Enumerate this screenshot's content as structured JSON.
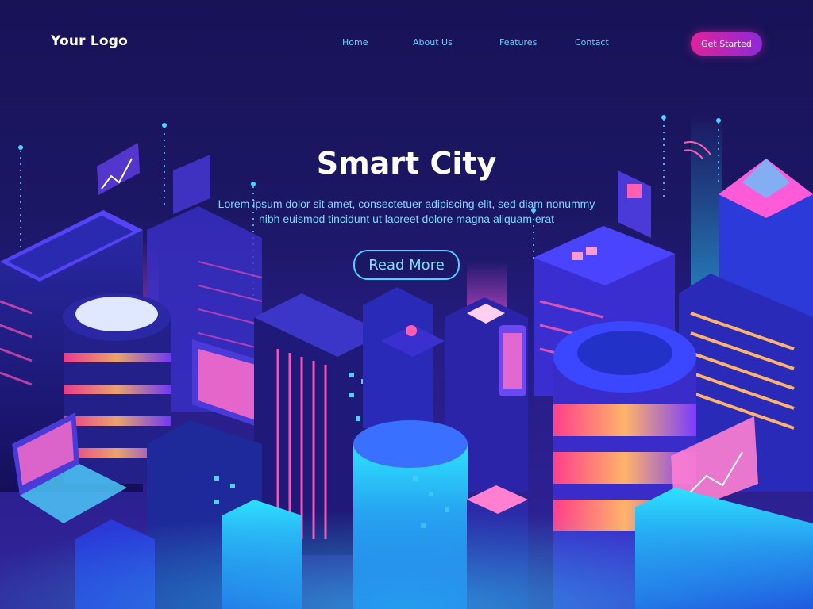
{
  "header": {
    "logo": "Your Logo",
    "nav": [
      {
        "label": "Home"
      },
      {
        "label": "About Us"
      },
      {
        "label": "Features"
      },
      {
        "label": "Contact"
      }
    ],
    "cta_label": "Get Started"
  },
  "hero": {
    "title": "Smart City",
    "text": "Lorem ipsum dolor sit amet, consectetuer adipiscing elit, sed diam nonummy nibh euismod tincidunt ut laoreet dolore magna aliquam erat",
    "button_label": "Read More"
  },
  "colors": {
    "background_top": "#120a3c",
    "background_bottom": "#3a2ab0",
    "accent_pink": "#e0229a",
    "accent_cyan": "#4fd2ff"
  }
}
